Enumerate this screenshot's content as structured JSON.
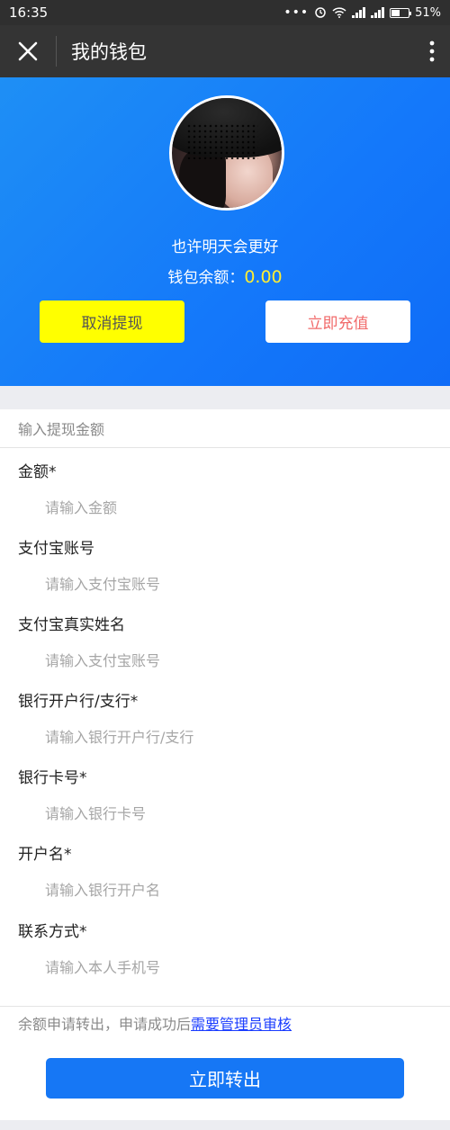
{
  "status_bar": {
    "time": "16:35",
    "battery": "51%",
    "battery_level": 0.51,
    "icons": [
      "more-dots-icon",
      "alarm-icon",
      "wifi-icon",
      "signal-icon",
      "signal-icon",
      "battery-icon"
    ]
  },
  "app_bar": {
    "title": "我的钱包",
    "close_icon": "close-icon",
    "more_icon": "more-vertical-icon"
  },
  "profile": {
    "name": "也许明天会更好",
    "balance_label": "钱包余额：",
    "balance_value": "0.00",
    "cancel_button": "取消提现",
    "recharge_button": "立即充值"
  },
  "form": {
    "section_title": "输入提现金额",
    "fields": [
      {
        "label": "金额*",
        "placeholder": "请输入金额"
      },
      {
        "label": "支付宝账号",
        "placeholder": "请输入支付宝账号"
      },
      {
        "label": "支付宝真实姓名",
        "placeholder": "请输入支付宝账号"
      },
      {
        "label": "银行开户行/支行*",
        "placeholder": "请输入银行开户行/支行"
      },
      {
        "label": "银行卡号*",
        "placeholder": "请输入银行卡号"
      },
      {
        "label": "开户名*",
        "placeholder": "请输入银行开户名"
      },
      {
        "label": "联系方式*",
        "placeholder": "请输入本人手机号"
      }
    ],
    "notice_text": "余额申请转出，申请成功后",
    "notice_link": "需要管理员审核",
    "submit_button": "立即转出"
  },
  "colors": {
    "hero_blue": "#1478fa",
    "cancel_yellow": "#ffff00",
    "recharge_red_text": "#f16b6b",
    "balance_yellow": "#ffee33",
    "submit_blue": "#1677f5"
  }
}
